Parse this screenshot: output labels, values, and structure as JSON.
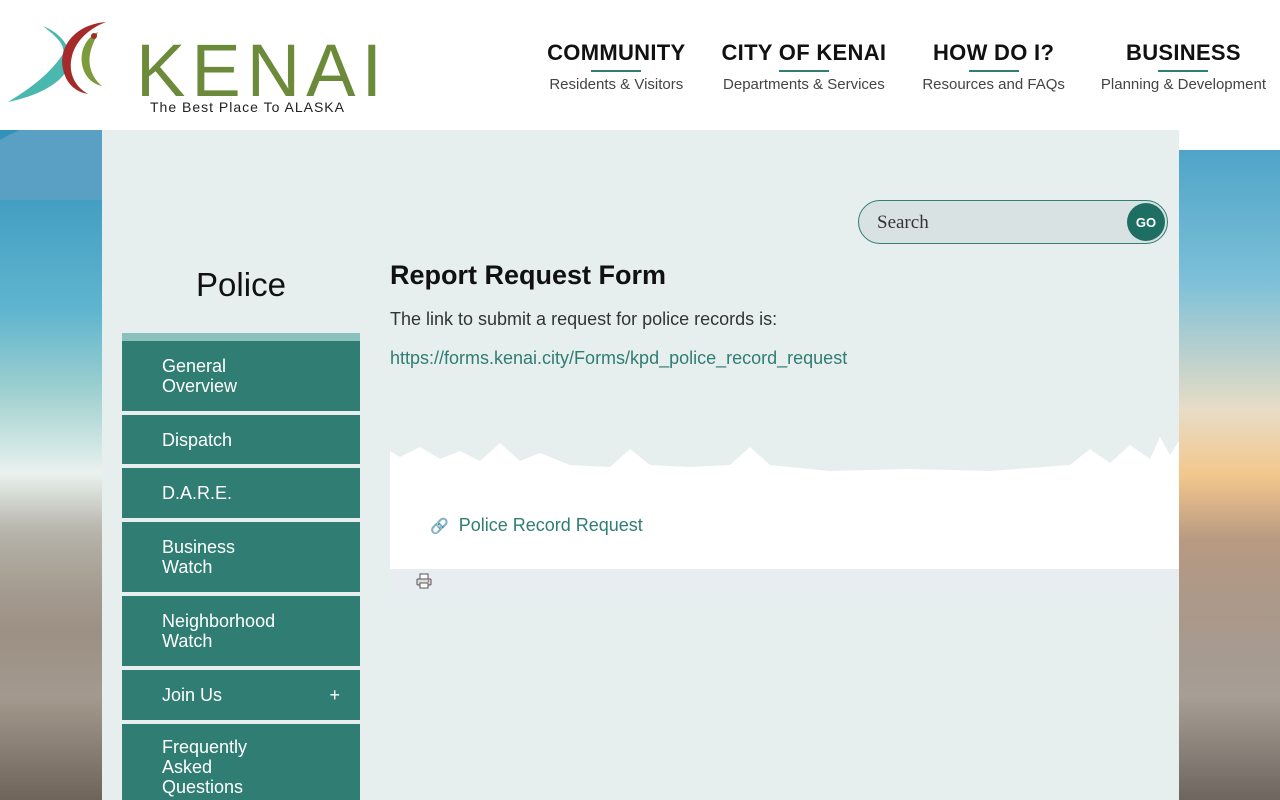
{
  "header": {
    "logo_text": "KENAI",
    "logo_tagline": "The Best Place To ALASKA",
    "nav": [
      {
        "title": "COMMUNITY",
        "subtitle": "Residents & Visitors"
      },
      {
        "title": "CITY OF KENAI",
        "subtitle": "Departments & Services"
      },
      {
        "title": "HOW DO I?",
        "subtitle": "Resources and FAQs"
      },
      {
        "title": "BUSINESS",
        "subtitle": "Planning & Development"
      }
    ]
  },
  "search": {
    "placeholder": "Search",
    "button_label": "GO"
  },
  "sidebar": {
    "title": "Police",
    "items": [
      {
        "label": "General\nOverview"
      },
      {
        "label": "Dispatch"
      },
      {
        "label": "D.A.R.E."
      },
      {
        "label": "Business\nWatch"
      },
      {
        "label": "Neighborhood\nWatch"
      },
      {
        "label": "Join Us",
        "expand": "+"
      },
      {
        "label": "Frequently\nAsked\nQuestions"
      }
    ]
  },
  "content": {
    "heading": "Report Request Form",
    "intro": "The link to submit a request for police records is:",
    "url": "https://forms.kenai.city/Forms/kpd_police_record_request",
    "related_link": "Police Record Request"
  },
  "colors": {
    "accent": "#2f7d73",
    "logo_green": "#6b8a3a",
    "panel_bg": "#e6efee"
  },
  "icons": [
    "logo-icon",
    "link-chain-icon",
    "print-icon"
  ]
}
